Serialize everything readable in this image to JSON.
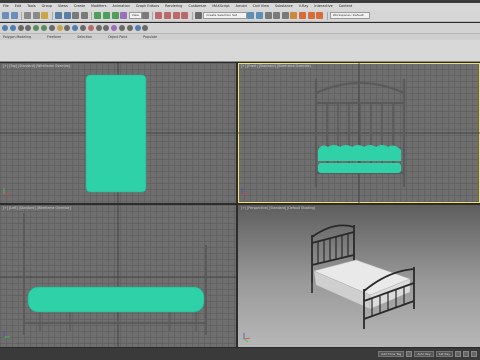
{
  "menu": {
    "items": [
      "File",
      "Edit",
      "Tools",
      "Group",
      "Views",
      "Create",
      "Modifiers",
      "Animation",
      "Graph Editors",
      "Rendering",
      "Customize",
      "MAXScript",
      "Arnold",
      "Civil View",
      "Substance",
      "V-Ray",
      "Interactive",
      "Content"
    ]
  },
  "toolbar": {
    "selection_set": "Create Selection Set",
    "workspace": "Workspaces: Default"
  },
  "subribbon": {
    "labels": [
      "Polygon Modeling",
      "Freeform",
      "Selection",
      "Object Paint",
      "Populate"
    ]
  },
  "viewports": {
    "top": {
      "label": "[+] [Top] [Standard] [Wireframe Override]"
    },
    "front": {
      "label": "[+] [Front] [Standard] [Wireframe Override]"
    },
    "left": {
      "label": "[+] [Left] [Standard] [Wireframe Override]"
    },
    "perspective": {
      "label": "[+] [Perspective] [Standard] [Default Shading]"
    }
  },
  "status": {
    "add_time_tag": "Add Time Tag",
    "auto_key": "Auto Key",
    "set_key": "Set Key"
  },
  "colors": {
    "mattress": "#2fd1a8",
    "active_outline": "#f2e06a",
    "frame": "#2a2a2a",
    "sheet": "#e9e9e9"
  }
}
